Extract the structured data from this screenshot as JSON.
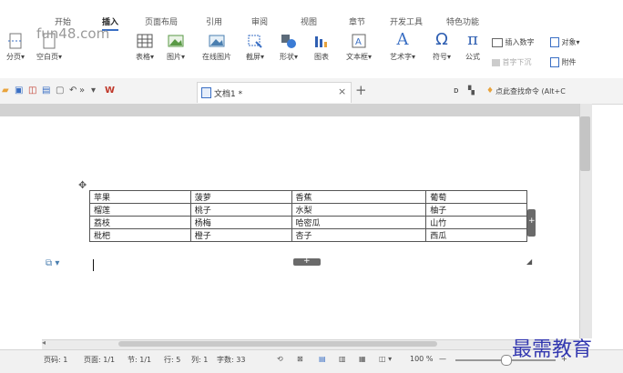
{
  "ribbon_tabs": [
    "开始",
    "插入",
    "页面布局",
    "引用",
    "审阅",
    "视图",
    "章节",
    "开发工具",
    "特色功能"
  ],
  "active_tab": "插入",
  "ribbon_buttons": [
    {
      "label": "分页▾",
      "icon": "page-break-icon"
    },
    {
      "label": "空白页▾",
      "icon": "blank-page-icon"
    },
    {
      "label": "表格▾",
      "icon": "table-icon"
    },
    {
      "label": "图片▾",
      "icon": "picture-icon"
    },
    {
      "label": "在线图片",
      "icon": "online-picture-icon"
    },
    {
      "label": "截屏▾",
      "icon": "screenshot-icon"
    },
    {
      "label": "形状▾",
      "icon": "shapes-icon"
    },
    {
      "label": "图表",
      "icon": "chart-icon"
    },
    {
      "label": "文本框▾",
      "icon": "textbox-icon"
    },
    {
      "label": "艺术字▾",
      "icon": "wordart-icon"
    },
    {
      "label": "符号▾",
      "icon": "symbol-icon"
    },
    {
      "label": "公式",
      "icon": "formula-icon"
    }
  ],
  "ribbon_small": {
    "insert_number": "插入数字",
    "object": "对象▾",
    "drop_cap": "首字下沉",
    "attachment": "附件"
  },
  "watermark_top": "fun48.com",
  "doc_tab": {
    "title": "文档1 *",
    "close": "×",
    "new": "+"
  },
  "search_command": "点此查找命令 (Alt+C",
  "table": [
    [
      "苹果",
      "菠萝",
      "香蕉",
      "葡萄"
    ],
    [
      "榴莲",
      "桃子",
      "水梨",
      "柚子"
    ],
    [
      "荔枝",
      "杨梅",
      "哈密瓜",
      "山竹"
    ],
    [
      "枇杷",
      "橙子",
      "杏子",
      "西瓜"
    ]
  ],
  "status": {
    "page": "页码: 1",
    "pages": "页面: 1/1",
    "section": "节: 1/1",
    "line": "行: 5",
    "column": "列: 1",
    "words": "字数: 33",
    "zoom": "100 %",
    "zoom_minus": "—",
    "zoom_plus": "+"
  },
  "watermark_bottom": "最需教育",
  "colors": {
    "accent": "#3a6fc4",
    "watermark": "#3338b0",
    "chart": "#2f5fb2"
  }
}
